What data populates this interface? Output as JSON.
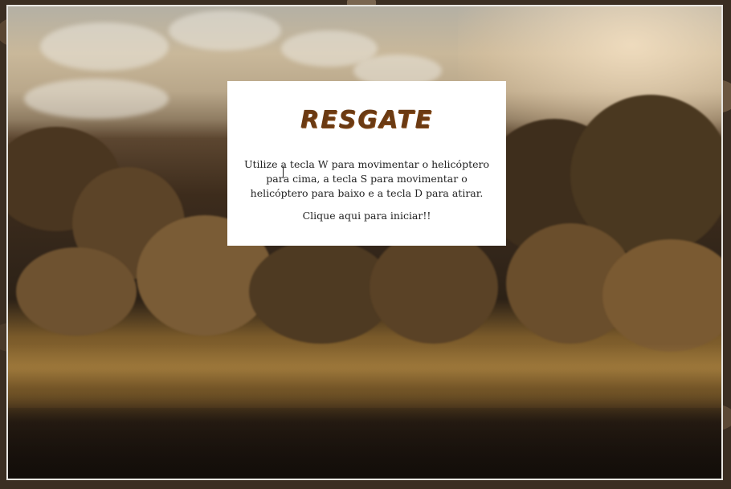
{
  "game": {
    "title": "RESGATE",
    "instructions": "Utilize a tecla W para movimentar o helicóptero para cima, a tecla S para movimentar o helicóptero para baixo e a tecla D para atirar.",
    "start_label": "Clique aqui para iniciar!!"
  },
  "colors": {
    "title": "#6b3a12",
    "panel_background": "#ffffff",
    "frame_border": "#e8e6e2"
  }
}
